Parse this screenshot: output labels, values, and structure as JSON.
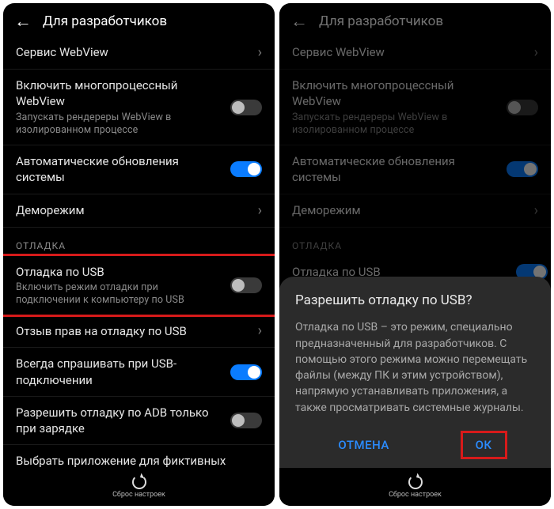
{
  "header": {
    "title": "Для разработчиков"
  },
  "rows": {
    "webview_service": {
      "title": "Сервис WebView"
    },
    "mp_webview": {
      "title": "Включить многопроцессный WebView",
      "sub": "Запускать рендереры WebView в изолированном процессе"
    },
    "auto_update": {
      "title": "Автоматические обновления системы"
    },
    "demo_mode": {
      "title": "Деморежим"
    },
    "section_debug": "ОТЛАДКА",
    "usb_debug": {
      "title": "Отладка по USB",
      "sub": "Включить режим отладки при подключении к компьютеру по USB"
    },
    "revoke_usb": {
      "title": "Отзыв прав на отладку по USB"
    },
    "always_ask_usb": {
      "title": "Всегда спрашивать при USB-подключении"
    },
    "adb_charge": {
      "title": "Разрешить отладку по ADB только при зарядке"
    },
    "mock_app": {
      "title": "Выбрать приложение для фиктивных"
    }
  },
  "bottom": {
    "reset_label": "Сброс настроек"
  },
  "dialog": {
    "title": "Разрешить отладку по USB?",
    "body": "Отладка по USB – это режим, специально предназначенный для разработчиков. С помощью этого режима можно перемещать файлы (между ПК и этим устройством), напрямую устанавливать приложения, а также просматривать системные журналы.",
    "cancel": "ОТМЕНА",
    "ok": "ОК"
  }
}
